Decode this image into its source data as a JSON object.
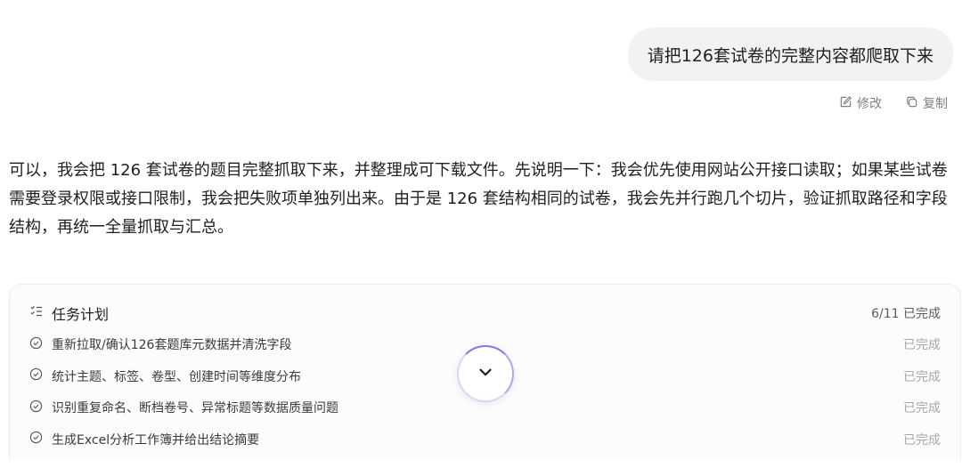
{
  "user_message": {
    "text": "请把126套试卷的完整内容都爬取下来",
    "edit_label": "修改",
    "copy_label": "复制"
  },
  "assistant_reply": {
    "text": "可以，我会把 126 套试卷的题目完整抓取下来，并整理成可下载文件。先说明一下：我会优先使用网站公开接口读取；如果某些试卷需要登录权限或接口限制，我会把失败项单独列出来。由于是 126 套结构相同的试卷，我会先并行跑几个切片，验证抓取路径和字段结构，再统一全量抓取与汇总。"
  },
  "task_plan": {
    "title": "任务计划",
    "progress": "6/11 已完成",
    "tasks": [
      {
        "label": "重新拉取/确认126套题库元数据并清洗字段",
        "status": "已完成"
      },
      {
        "label": "统计主题、标签、卷型、创建时间等维度分布",
        "status": "已完成"
      },
      {
        "label": "识别重复命名、断档卷号、异常标题等数据质量问题",
        "status": "已完成"
      },
      {
        "label": "生成Excel分析工作簿并给出结论摘要",
        "status": "已完成"
      }
    ]
  },
  "icons": {
    "edit": "edit-icon",
    "copy": "copy-icon",
    "plan": "task-list-icon",
    "task_done": "check-circle-icon",
    "collapse": "chevron-down-icon"
  },
  "colors": {
    "bubble_bg": "#f2f2f3",
    "muted_text": "#a8a8a8",
    "accent": "#8b73e6"
  }
}
